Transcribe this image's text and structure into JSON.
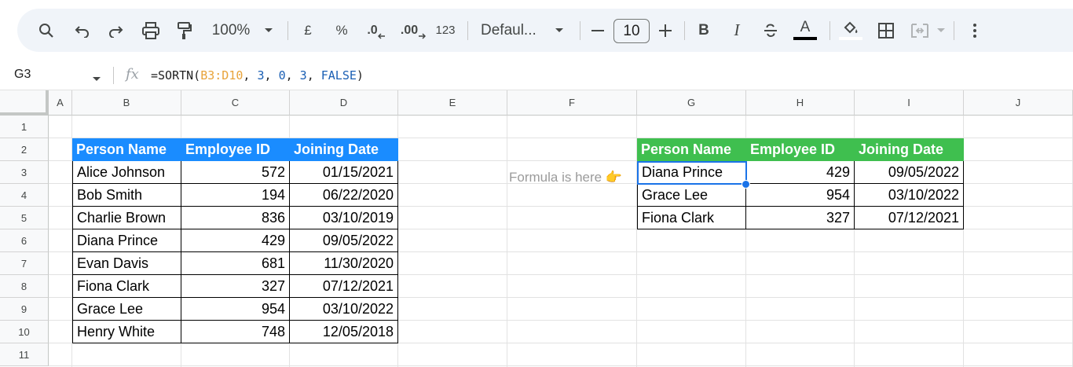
{
  "toolbar": {
    "zoom": "100%",
    "currency": "£",
    "percent": "%",
    "decrease_decimal": ".0",
    "increase_decimal": ".00",
    "number_format": "123",
    "font": "Defaul...",
    "font_size": "10",
    "bold": "B",
    "italic": "I",
    "text_color_letter": "A"
  },
  "formula_bar": {
    "cell_ref": "G3",
    "fx": "fx",
    "formula_prefix": "=SORTN(",
    "formula_range": "B3:D10",
    "formula_sep1": ", ",
    "formula_n": "3",
    "formula_sep2": ", ",
    "formula_mode": "0",
    "formula_sep3": ", ",
    "formula_col": "3",
    "formula_sep4": ", ",
    "formula_bool": "FALSE",
    "formula_suffix": ")"
  },
  "columns": [
    "A",
    "B",
    "C",
    "D",
    "E",
    "F",
    "G",
    "H",
    "I",
    "J"
  ],
  "rows": [
    "1",
    "2",
    "3",
    "4",
    "5",
    "6",
    "7",
    "8",
    "9",
    "10",
    "11"
  ],
  "source_table": {
    "headers": [
      "Person Name",
      "Employee ID",
      "Joining Date"
    ],
    "rows": [
      [
        "Alice Johnson",
        "572",
        "01/15/2021"
      ],
      [
        "Bob Smith",
        "194",
        "06/22/2020"
      ],
      [
        "Charlie Brown",
        "836",
        "03/10/2019"
      ],
      [
        "Diana Prince",
        "429",
        "09/05/2022"
      ],
      [
        "Evan Davis",
        "681",
        "11/30/2020"
      ],
      [
        "Fiona Clark",
        "327",
        "07/12/2021"
      ],
      [
        "Grace Lee",
        "954",
        "03/10/2022"
      ],
      [
        "Henry White",
        "748",
        "12/05/2018"
      ]
    ]
  },
  "note": "Formula is here 👉",
  "result_table": {
    "headers": [
      "Person Name",
      "Employee ID",
      "Joining Date"
    ],
    "rows": [
      [
        "Diana Prince",
        "429",
        "09/05/2022"
      ],
      [
        "Grace Lee",
        "954",
        "03/10/2022"
      ],
      [
        "Fiona Clark",
        "327",
        "07/12/2021"
      ]
    ]
  },
  "colors": {
    "source_header": "#1a8cff",
    "result_header": "#3fbf4f",
    "selection": "#1a73e8"
  }
}
